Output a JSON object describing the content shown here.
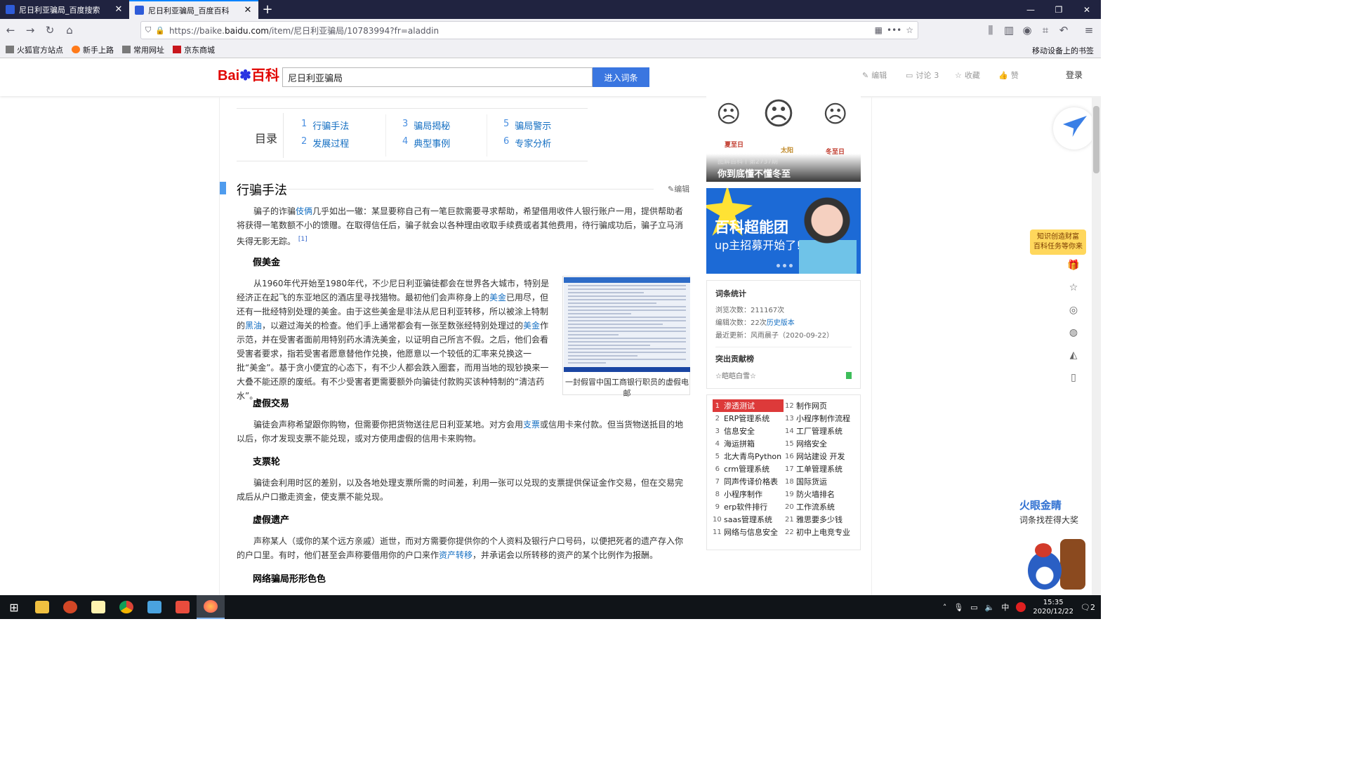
{
  "browser": {
    "tabs": [
      {
        "title": "尼日利亚骗局_百度搜索"
      },
      {
        "title": "尼日利亚骗局_百度百科"
      }
    ],
    "url_prefix": "https://baike.",
    "url_domain": "baidu.com",
    "url_path": "/item/尼日利亚骗局/10783994?fr=aladdin",
    "bookmarks": [
      "火狐官方站点",
      "新手上路",
      "常用网址",
      "京东商城"
    ],
    "mobile_bookmarks": "移动设备上的书签"
  },
  "header": {
    "logo_text": "Bai",
    "logo_paw": "百科",
    "search_value": "尼日利亚骗局",
    "search_button": "进入词条",
    "edit": "编辑",
    "discuss": "讨论",
    "discuss_count": "3",
    "collect": "收藏",
    "like": "赞",
    "login": "登录"
  },
  "catalog": {
    "title": "目录",
    "items": [
      {
        "num": "1",
        "label": "行骗手法"
      },
      {
        "num": "2",
        "label": "发展过程"
      },
      {
        "num": "3",
        "label": "骗局揭秘"
      },
      {
        "num": "4",
        "label": "典型事例"
      },
      {
        "num": "5",
        "label": "骗局警示"
      },
      {
        "num": "6",
        "label": "专家分析"
      }
    ]
  },
  "section": {
    "title": "行骗手法",
    "edit": "编辑",
    "p1a": "骗子的诈骗",
    "p1link": "伎俩",
    "p1b": "几乎如出一辙：某显要称自己有一笔巨款需要寻求帮助，希望借用收件人银行账户一用，提供帮助者将获得一笔数额不小的馈赠。在取得信任后，骗子就会以各种理由收取手续费或者其他费用，待行骗成功后，骗子立马消失得无影无踪。",
    "p1ref": "[1]",
    "sub1": "假美金",
    "p2a": "从1960年代开始至1980年代，不少尼日利亚骗徒都会在世界各大城市，特别是经济正在起飞的东亚地区的酒店里寻找猎物。最初他们会声称身上的",
    "p2l1": "美金",
    "p2b": "已用尽，但还有一批经特别处理的美金。由于这些美金是非法从尼日利亚转移，所以被涂上特制的",
    "p2l2": "黑油",
    "p2c": "，以避过海关的检查。他们手上通常都会有一张至数张经特别处理过的",
    "p2l3": "美金",
    "p2d": "作示范，并在受害者面前用特别药水清洗美金，以证明自己所言不假。之后，他们会看受害者要求，指若受害者愿意替他作兑换，他愿意以一个较低的汇率来兑换这一批“美金”。基于贪小便宜的心态下，有不少人都会跌入圈套，而用当地的现钞换来一大叠不能还原的废纸。有不少受害者更需要额外向骗徒付款购买该种特制的“清洁药水”。",
    "fig_caption": "一封假冒中国工商银行职员的虚假电邮",
    "sub2": "虚假交易",
    "p3a": "骗徒会声称希望跟你购物，但需要你把货物送往尼日利亚某地。对方会用",
    "p3l": "支票",
    "p3b": "或信用卡来付款。但当货物送抵目的地以后，你才发现支票不能兑现，或对方使用虚假的信用卡来购物。",
    "sub3": "支票轮",
    "p4": "骗徒会利用时区的差别，以及各地处理支票所需的时间差，利用一张可以兑现的支票提供保证金作交易，但在交易完成后从户口撤走资金，使支票不能兑现。",
    "sub4": "虚假遗产",
    "p5a": "声称某人（或你的某个远方亲戚）逝世，而对方需要你提供你的个人资料及银行户口号码，以便把死者的遗产存入你的户口里。有时，他们甚至会声称要借用你的户口来作",
    "p5l": "资产转移",
    "p5b": "，并承诺会以所转移的资产的某个比例作为报酬。",
    "sub5": "网络骗局形形色色"
  },
  "sidebar": {
    "ad1_labels": [
      "夏至日",
      "太阳",
      "冬至日"
    ],
    "ad1_cap1": "图解百科丨第2737期",
    "ad1_cap2": "你到底懂不懂冬至",
    "ad2_t1": "百科超能团",
    "ad2_t2": "up主招募开始了!",
    "stats_title": "词条统计",
    "views_label": "浏览次数：",
    "views": "211167次",
    "edits_label": "编辑次数：",
    "edits": "22次",
    "history_link": "历史版本",
    "updated_label": "最近更新：",
    "updated": "风雨晨子（2020-09-22）",
    "contrib_title": "突出贡献榜",
    "contrib_user": "☆皑皑白雪☆",
    "hot": [
      {
        "n": "1",
        "t": "渗透测试"
      },
      {
        "n": "12",
        "t": "制作网页"
      },
      {
        "n": "2",
        "t": "ERP管理系统"
      },
      {
        "n": "13",
        "t": "小程序制作流程"
      },
      {
        "n": "3",
        "t": "信息安全"
      },
      {
        "n": "14",
        "t": "工厂管理系统"
      },
      {
        "n": "4",
        "t": "海运拼箱"
      },
      {
        "n": "15",
        "t": "网络安全"
      },
      {
        "n": "5",
        "t": "北大青鸟Python"
      },
      {
        "n": "16",
        "t": "网站建设 开发"
      },
      {
        "n": "6",
        "t": "crm管理系统"
      },
      {
        "n": "17",
        "t": "工单管理系统"
      },
      {
        "n": "7",
        "t": "同声传译价格表"
      },
      {
        "n": "18",
        "t": "国际货运"
      },
      {
        "n": "8",
        "t": "小程序制作"
      },
      {
        "n": "19",
        "t": "防火墙排名"
      },
      {
        "n": "9",
        "t": "erp软件排行"
      },
      {
        "n": "20",
        "t": "工作流系统"
      },
      {
        "n": "10",
        "t": "saas管理系统"
      },
      {
        "n": "21",
        "t": "雅思要多少钱"
      },
      {
        "n": "11",
        "t": "网络与信息安全"
      },
      {
        "n": "22",
        "t": "初中上电竞专业"
      }
    ]
  },
  "floating": {
    "promo_l1": "知识创造财富",
    "promo_l2": "百科任务等你来",
    "huoyan_title": "火眼金睛",
    "huoyan_sub": "词条找茬得大奖"
  },
  "taskbar": {
    "ime": "中",
    "time": "15:35",
    "date": "2020/12/22",
    "notif": "2"
  }
}
